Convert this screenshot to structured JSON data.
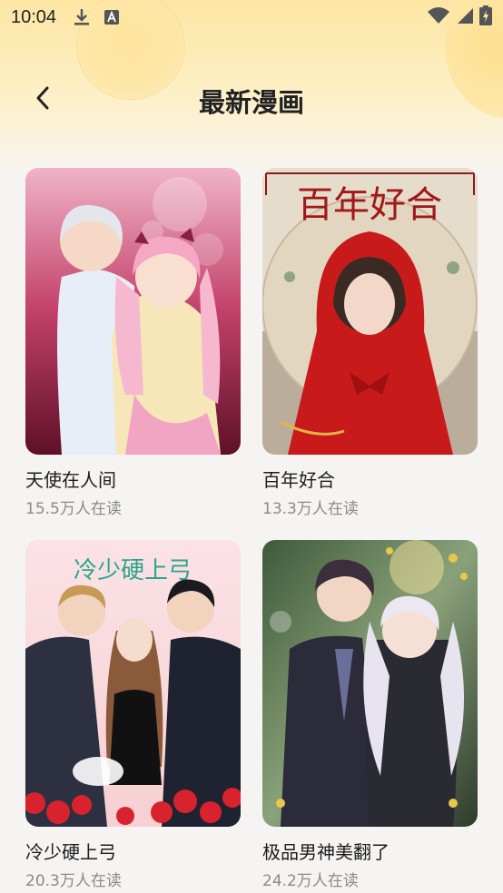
{
  "status_bar": {
    "time": "10:04",
    "left_icons": [
      "download-icon",
      "text-a-icon"
    ],
    "right_icons": [
      "wifi-icon",
      "signal-icon",
      "battery-charging-icon"
    ]
  },
  "header": {
    "title": "最新漫画",
    "back_icon": "chevron-left-icon",
    "gradient_top": "#fde6a3",
    "gradient_bottom": "#f5f4f3"
  },
  "comics": [
    {
      "title": "天使在人间",
      "readers": "15.5万人在读",
      "cover_text": ""
    },
    {
      "title": "百年好合",
      "readers": "13.3万人在读",
      "cover_text": "百年好合"
    },
    {
      "title": "冷少硬上弓",
      "readers": "20.3万人在读",
      "cover_text": "冷少硬上弓"
    },
    {
      "title": "极品男神美翻了",
      "readers": "24.2万人在读",
      "cover_text": ""
    }
  ]
}
